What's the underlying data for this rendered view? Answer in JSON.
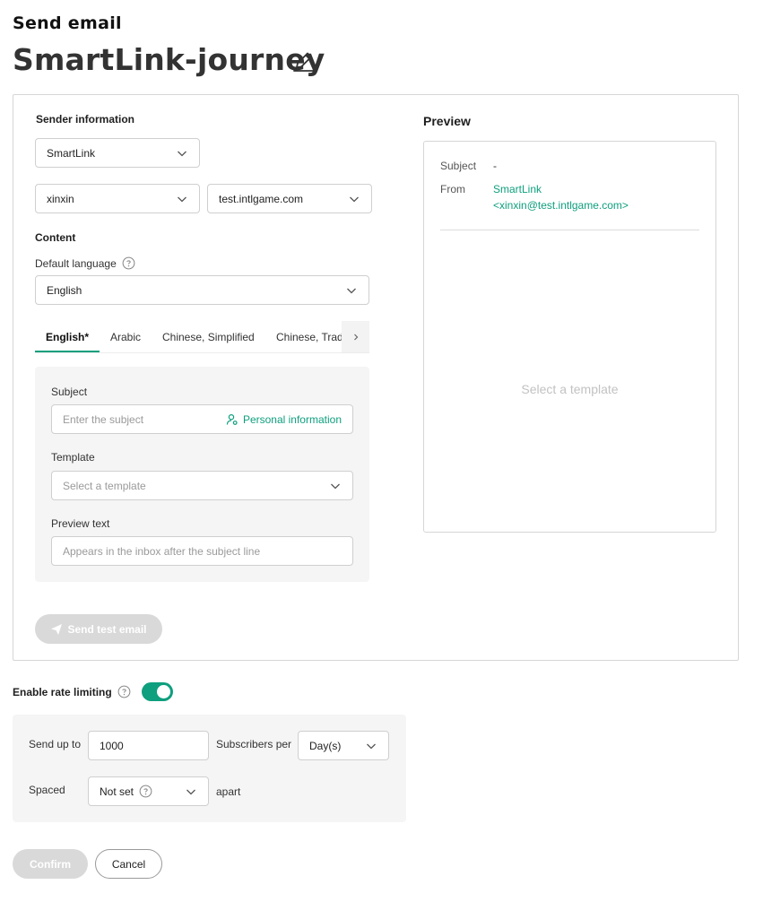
{
  "header": {
    "kicker": "Send email",
    "title": "SmartLink-journey"
  },
  "sender": {
    "section_label": "Sender information",
    "sender_name": "SmartLink",
    "local_part": "xinxin",
    "domain": "test.intlgame.com"
  },
  "content": {
    "section_label": "Content",
    "default_language_label": "Default language",
    "default_language_value": "English",
    "tabs": [
      {
        "label": "English*"
      },
      {
        "label": "Arabic"
      },
      {
        "label": "Chinese, Simplified"
      },
      {
        "label": "Chinese, Trad"
      }
    ],
    "subject_label": "Subject",
    "subject_placeholder": "Enter the subject",
    "personal_info_label": "Personal information",
    "template_label": "Template",
    "template_placeholder": "Select a template",
    "preview_text_label": "Preview text",
    "preview_text_placeholder": "Appears in the inbox after the subject line",
    "send_test_label": "Send test email"
  },
  "preview": {
    "title": "Preview",
    "subject_key": "Subject",
    "subject_value": "-",
    "from_key": "From",
    "from_name": "SmartLink",
    "from_address": "<xinxin@test.intlgame.com>",
    "empty_message": "Select a template"
  },
  "rate_limiting": {
    "label": "Enable rate limiting",
    "enabled": true,
    "send_up_to_label": "Send up to",
    "send_up_to_value": "1000",
    "subscribers_per_label": "Subscribers per",
    "period_value": "Day(s)",
    "spaced_label": "Spaced",
    "spaced_value": "Not set",
    "apart_label": "apart"
  },
  "footer": {
    "confirm_label": "Confirm",
    "cancel_label": "Cancel"
  },
  "colors": {
    "accent": "#0e9f7e",
    "disabled": "#d9d9d9"
  }
}
